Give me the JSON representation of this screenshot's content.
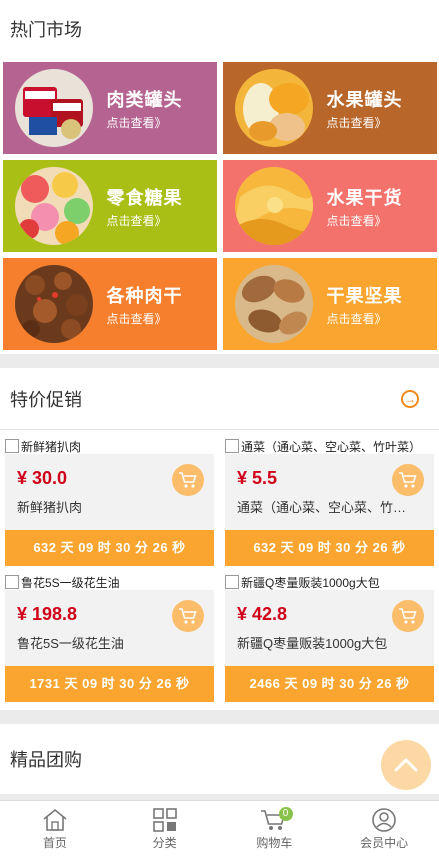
{
  "hot_market": {
    "title": "热门市场",
    "tiles": [
      {
        "label": "肉类罐头",
        "sub": "点击查看》",
        "color": "#b56491",
        "thumb": "canned-meat"
      },
      {
        "label": "水果罐头",
        "sub": "点击查看》",
        "color": "#b8662a",
        "thumb": "canned-fruit"
      },
      {
        "label": "零食糖果",
        "sub": "点击查看》",
        "color": "#a9bf16",
        "thumb": "candy"
      },
      {
        "label": "水果干货",
        "sub": "点击查看》",
        "color": "#f4726c",
        "thumb": "dried-fruit"
      },
      {
        "label": "各种肉干",
        "sub": "点击查看》",
        "color": "#f57f2d",
        "thumb": "jerky"
      },
      {
        "label": "干果坚果",
        "sub": "点击查看》",
        "color": "#f9a52f",
        "thumb": "nuts"
      }
    ]
  },
  "promo": {
    "title": "特价促销",
    "more_icon": "arrow-right-circle-icon",
    "items": [
      {
        "name": "新鲜猪扒肉",
        "price": "¥ 30.0",
        "desc": "新鲜猪扒肉",
        "timer": "632 天 09 时 30 分 26 秒"
      },
      {
        "name": "通菜（通心菜、空心菜、竹叶菜）",
        "price": "¥ 5.5",
        "desc": "通菜（通心菜、空心菜、竹叶菜）",
        "timer": "632 天 09 时 30 分 26 秒"
      },
      {
        "name": "鲁花5S一级花生油",
        "price": "¥ 198.8",
        "desc": "鲁花5S一级花生油",
        "timer": "1731 天 09 时 30 分 26 秒"
      },
      {
        "name": "新疆Q枣量贩装1000g大包",
        "price": "¥ 42.8",
        "desc": "新疆Q枣量贩装1000g大包",
        "timer": "2466 天 09 时 30 分 26 秒"
      }
    ]
  },
  "group": {
    "title": "精品团购"
  },
  "tabbar": {
    "items": [
      {
        "label": "首页",
        "icon": "home-icon"
      },
      {
        "label": "分类",
        "icon": "category-icon"
      },
      {
        "label": "购物车",
        "icon": "cart-icon",
        "badge": "0"
      },
      {
        "label": "会员中心",
        "icon": "user-icon"
      }
    ]
  }
}
